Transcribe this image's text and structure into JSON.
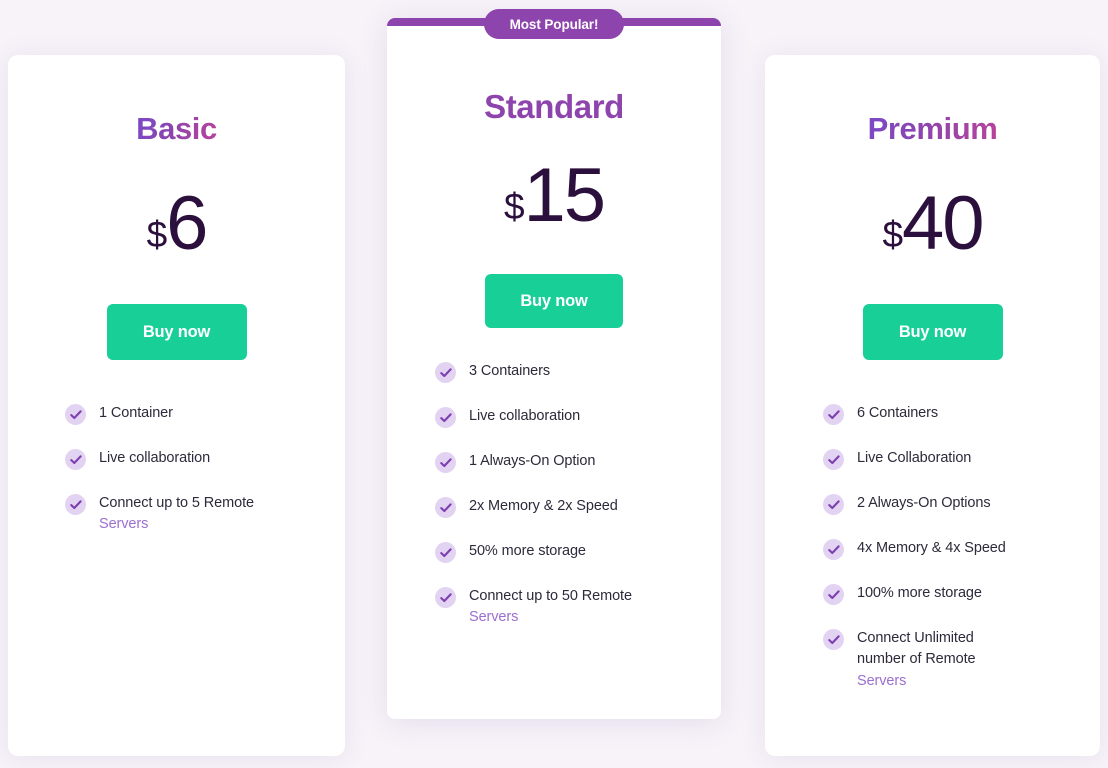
{
  "theme": {
    "background": "#f7f3f9",
    "card_background": "#ffffff",
    "accent_purple": "#8e44ad",
    "accent_green": "#17cf97",
    "price_color": "#2b0f3c",
    "check_circle": "#e3d3f2",
    "check_mark": "#7e3fb0",
    "link_color": "#9b6fd0",
    "title_gradient_start": "#7a4ac6",
    "title_gradient_end": "#b8439b"
  },
  "badge": {
    "label": "Most Popular!"
  },
  "plans": [
    {
      "id": "basic",
      "title": "Basic",
      "currency": "$",
      "price": "6",
      "cta": "Buy now",
      "features": [
        {
          "text": "1 Container",
          "link": ""
        },
        {
          "text": "Live collaboration",
          "link": ""
        },
        {
          "text": "Connect up to 5 Remote",
          "link": "Servers"
        }
      ]
    },
    {
      "id": "standard",
      "title": "Standard",
      "currency": "$",
      "price": "15",
      "cta": "Buy now",
      "features": [
        {
          "text": "3 Containers",
          "link": ""
        },
        {
          "text": "Live collaboration",
          "link": ""
        },
        {
          "text": "1 Always-On Option",
          "link": ""
        },
        {
          "text": "2x Memory & 2x Speed",
          "link": ""
        },
        {
          "text": "50% more storage",
          "link": ""
        },
        {
          "text": "Connect up to 50 Remote",
          "link": "Servers"
        }
      ]
    },
    {
      "id": "premium",
      "title": "Premium",
      "currency": "$",
      "price": "40",
      "cta": "Buy now",
      "features": [
        {
          "text": "6 Containers",
          "link": ""
        },
        {
          "text": "Live Collaboration",
          "link": ""
        },
        {
          "text": "2 Always-On Options",
          "link": ""
        },
        {
          "text": "4x Memory & 4x Speed",
          "link": ""
        },
        {
          "text": "100% more storage",
          "link": ""
        },
        {
          "text": "Connect Unlimited number of Remote",
          "link": "Servers"
        }
      ]
    }
  ]
}
